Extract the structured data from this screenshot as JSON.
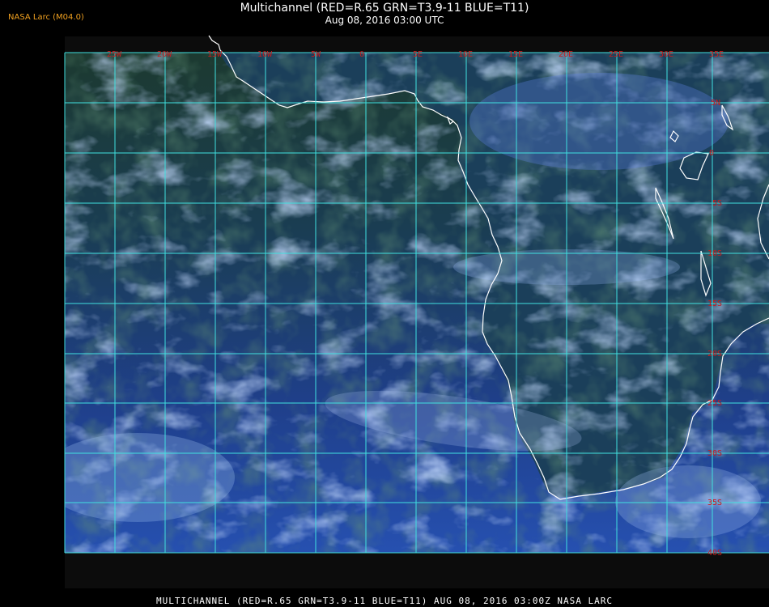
{
  "header": {
    "brand": "NASA Larc (M04.0)",
    "title": "Multichannel (RED=R.65 GRN=T3.9-11 BLUE=T11)",
    "subtitle": "Aug 08, 2016 03:00 UTC"
  },
  "map": {
    "longitude_labels": [
      "25W",
      "20W",
      "15W",
      "10W",
      "5W",
      "0",
      "5E",
      "10E",
      "15E",
      "20E",
      "25E",
      "30E",
      "35E"
    ],
    "latitude_labels": [
      "5N",
      "0",
      "5S",
      "10S",
      "15S",
      "20S",
      "25S",
      "30S",
      "35S",
      "40S"
    ],
    "grid_color": "#40e0e0",
    "coastline_color": "#ffffff",
    "label_color": "#cc1a1a",
    "ocean_color": "#1f3c8a",
    "land_color": "#1e4a2a",
    "cloud_color": "#8fb0f0"
  },
  "footer": {
    "text": "MULTICHANNEL (RED=R.65 GRN=T3.9-11 BLUE=T11) AUG 08, 2016 03:00Z    NASA LARC"
  }
}
